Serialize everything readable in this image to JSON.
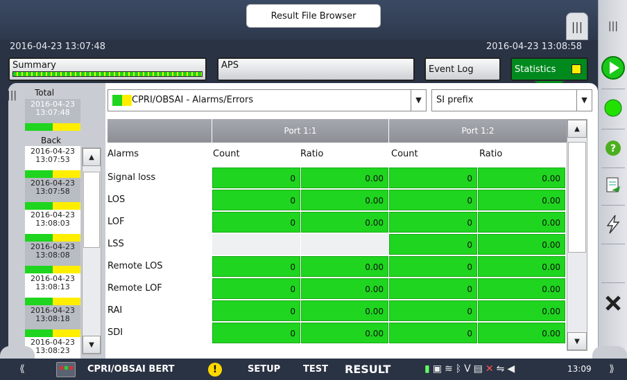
{
  "title_tab": "Result File Browser",
  "timestamps": {
    "start": "2016-04-23 13:07:48",
    "end": "2016-04-23 13:08:58"
  },
  "tabs": {
    "summary": "Summary",
    "aps": "APS",
    "event_log": "Event Log",
    "statistics": "Statistics"
  },
  "history": {
    "total_label": "Total",
    "back_label": "Back",
    "total_item": {
      "date": "2016-04-23",
      "time": "13:07:48"
    },
    "items": [
      {
        "date": "2016-04-23",
        "time": "13:07:53"
      },
      {
        "date": "2016-04-23",
        "time": "13:07:58"
      },
      {
        "date": "2016-04-23",
        "time": "13:08:03"
      },
      {
        "date": "2016-04-23",
        "time": "13:08:08"
      },
      {
        "date": "2016-04-23",
        "time": "13:08:13"
      },
      {
        "date": "2016-04-23",
        "time": "13:08:18"
      },
      {
        "date": "2016-04-23",
        "time": "13:08:23"
      }
    ]
  },
  "selectors": {
    "view": "CPRI/OBSAI - Alarms/Errors",
    "prefix": "SI prefix"
  },
  "table": {
    "ports": [
      "Port 1:1",
      "Port 1:2"
    ],
    "columns": {
      "name": "Alarms",
      "count": "Count",
      "ratio": "Ratio"
    },
    "rows": [
      {
        "name": "Signal loss",
        "p1_count": "0",
        "p1_ratio": "0.00",
        "p2_count": "0",
        "p2_ratio": "0.00"
      },
      {
        "name": "LOS",
        "p1_count": "0",
        "p1_ratio": "0.00",
        "p2_count": "0",
        "p2_ratio": "0.00"
      },
      {
        "name": "LOF",
        "p1_count": "0",
        "p1_ratio": "0.00",
        "p2_count": "0",
        "p2_ratio": "0.00"
      },
      {
        "name": "LSS",
        "p1_count": "",
        "p1_ratio": "",
        "p2_count": "0",
        "p2_ratio": "0.00"
      },
      {
        "name": "Remote LOS",
        "p1_count": "0",
        "p1_ratio": "0.00",
        "p2_count": "0",
        "p2_ratio": "0.00"
      },
      {
        "name": "Remote LOF",
        "p1_count": "0",
        "p1_ratio": "0.00",
        "p2_count": "0",
        "p2_ratio": "0.00"
      },
      {
        "name": "RAI",
        "p1_count": "0",
        "p1_ratio": "0.00",
        "p2_count": "0",
        "p2_ratio": "0.00"
      },
      {
        "name": "SDI",
        "p1_count": "0",
        "p1_ratio": "0.00",
        "p2_count": "0",
        "p2_ratio": "0.00"
      }
    ]
  },
  "bottom_bar": {
    "app_name": "CPRI/OBSAI BERT",
    "setup": "SETUP",
    "test": "TEST",
    "result": "RESULT",
    "clock": "13:09"
  },
  "colors": {
    "ok_green": "#1fd51f",
    "warn_yellow": "#ffee00",
    "stats_tab": "#008a1e"
  }
}
